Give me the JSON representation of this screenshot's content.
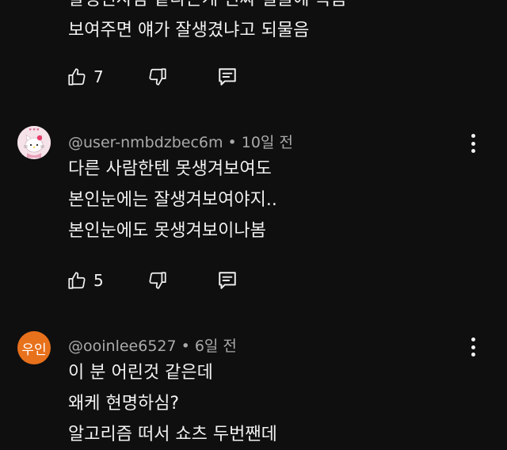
{
  "comments": [
    {
      "lines": [
        "잘생긴사람 같다는게 진짜 얼굴에 목좀",
        "보여주면 얘가 잘생겼냐고 되물음"
      ],
      "likes": "7"
    },
    {
      "avatar_icon": "hello-kitty-avatar",
      "username": "@user-nmbdzbec6m",
      "time": "10일 전",
      "lines": [
        "다른 사람한텐 못생겨보여도",
        "본인눈에는 잘생겨보여야지..",
        "본인눈에도 못생겨보이나봄"
      ],
      "likes": "5"
    },
    {
      "avatar_text": "우인",
      "avatar_color": "#e8711c",
      "username": "@ooinlee6527",
      "time": "6일 전",
      "lines": [
        "이 분 어린것 같은데",
        "왜케 현명하심?",
        "알고리즘 떠서 쇼츠 두번짼데"
      ]
    }
  ],
  "icons": {
    "like": "thumbs-up-icon",
    "dislike": "thumbs-down-icon",
    "reply": "reply-icon",
    "more": "more-vert-icon"
  },
  "colors": {
    "background": "#0f0f0f",
    "text": "#f1f1f1",
    "meta": "#aaaaaa"
  }
}
